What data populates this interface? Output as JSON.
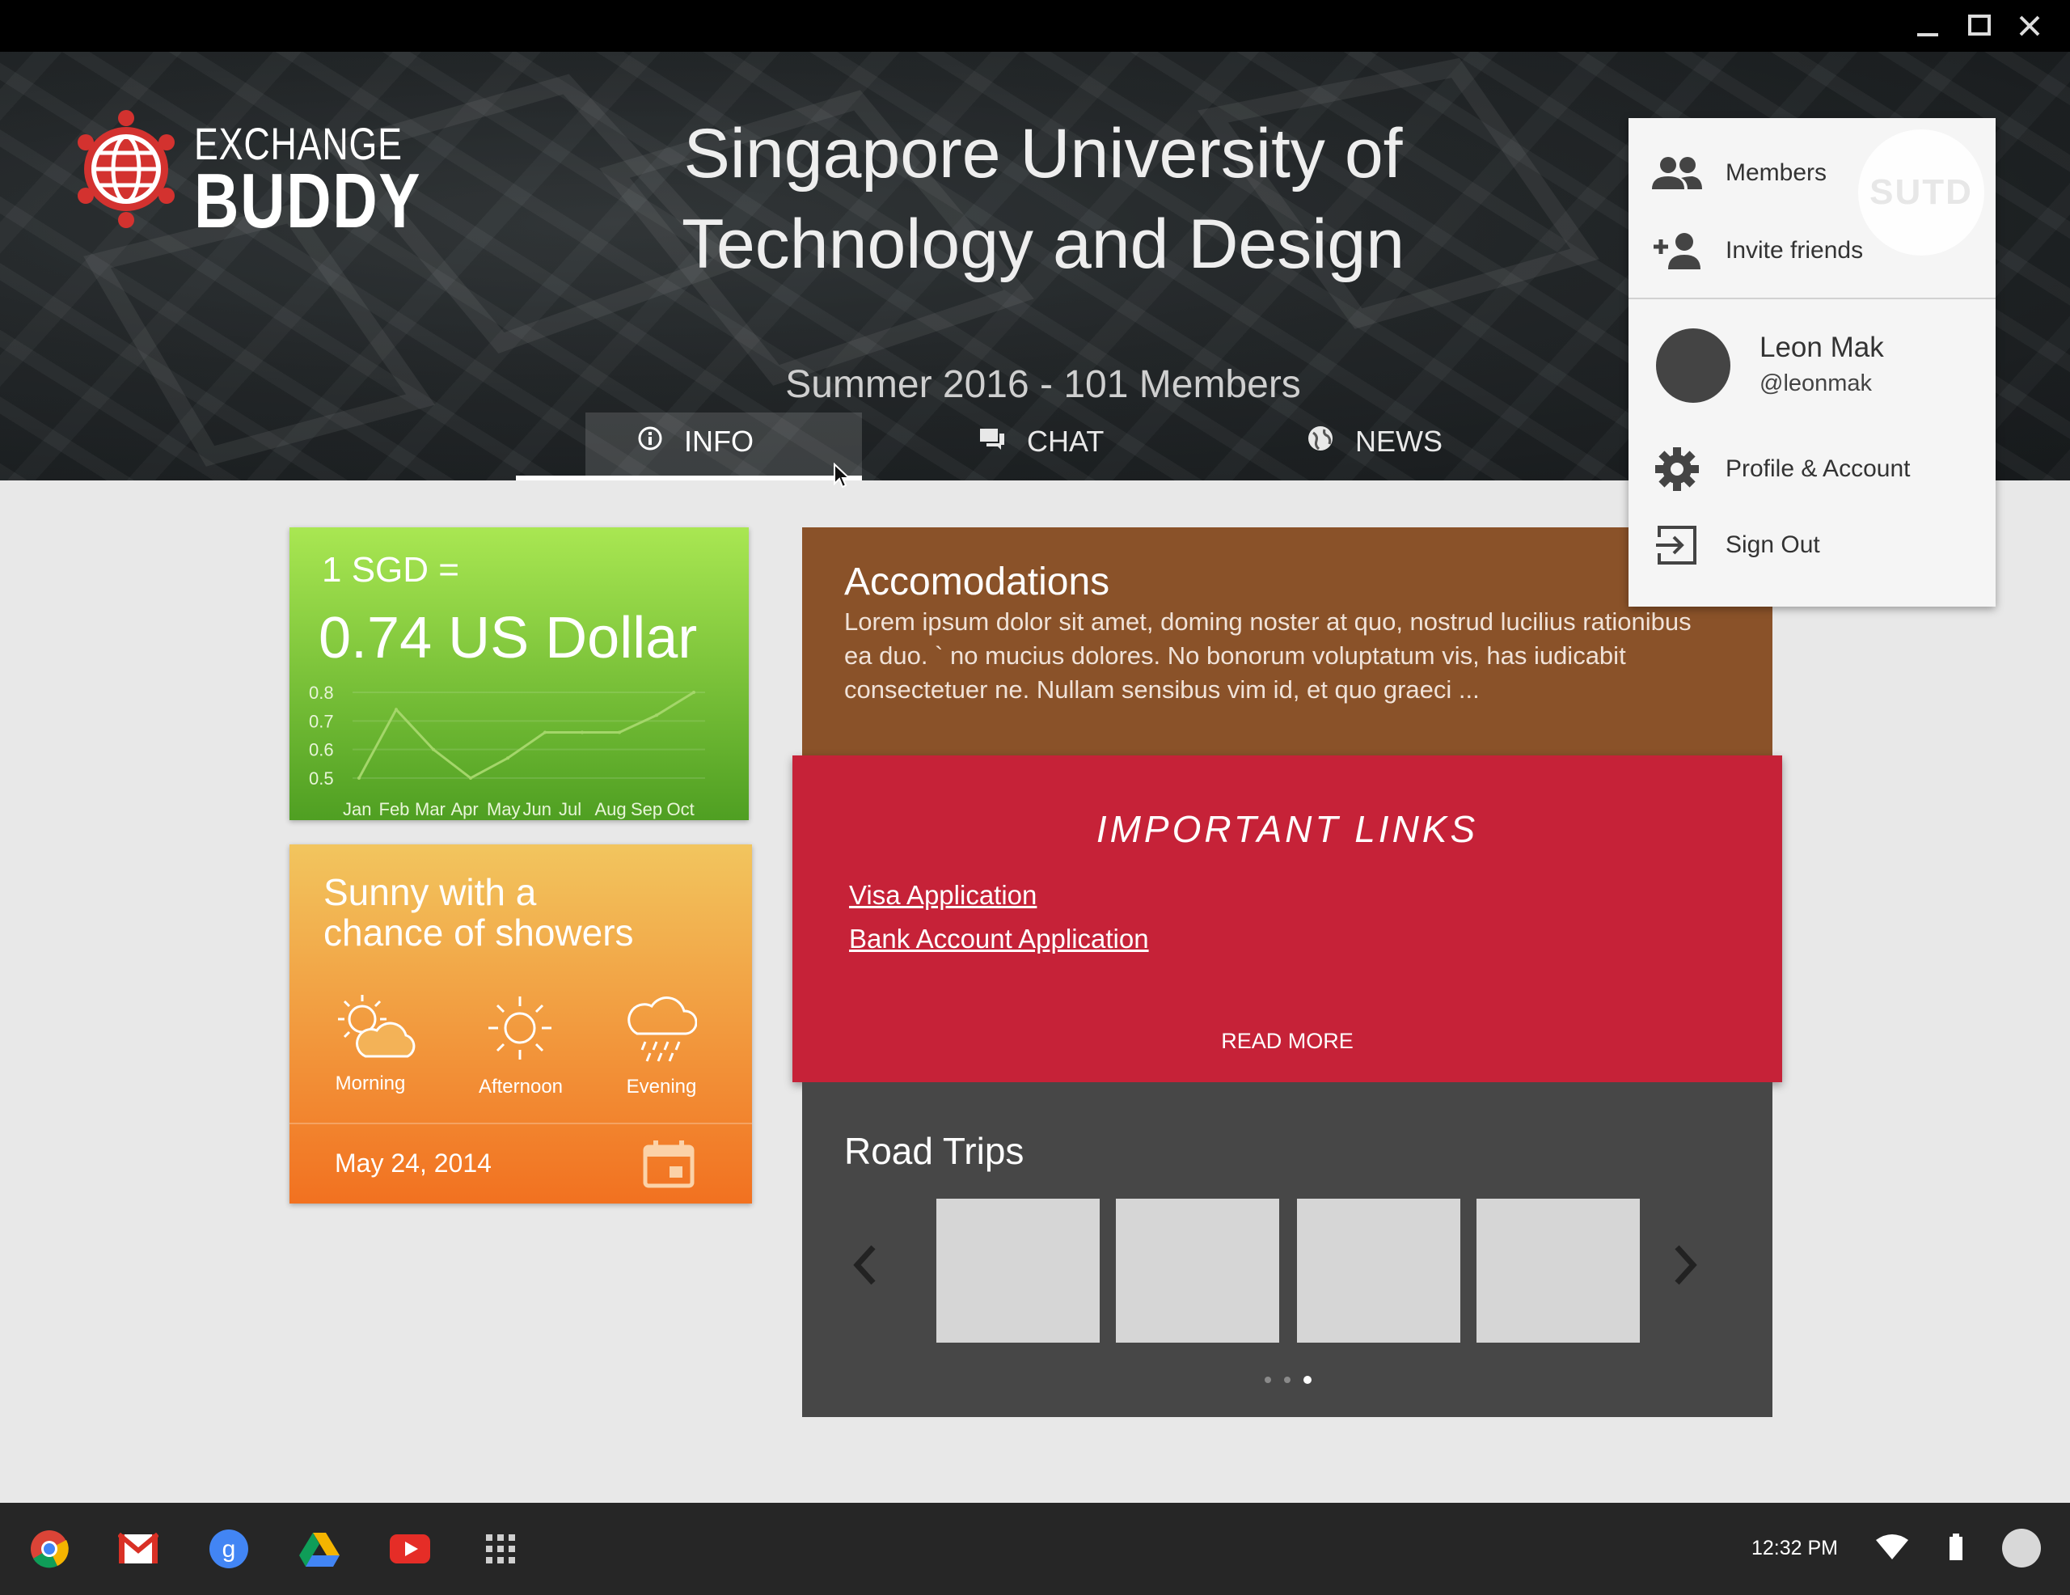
{
  "window": {
    "minimize_icon": "minimize-icon",
    "maximize_icon": "maximize-icon",
    "close_icon": "close-icon"
  },
  "header": {
    "logo_line1": "EXCHANGE",
    "logo_line2": "BUDDY",
    "title_line1": "Singapore University of",
    "title_line2": "Technology and Design",
    "subtitle": "Summer 2016 - 101 Members",
    "tabs": [
      {
        "label": "INFO",
        "icon": "info-icon",
        "active": true
      },
      {
        "label": "CHAT",
        "icon": "chat-icon",
        "active": false
      },
      {
        "label": "NEWS",
        "icon": "globe-icon",
        "active": false
      }
    ]
  },
  "currency": {
    "line1": "1 SGD =",
    "line2": "0.74 US Dollar",
    "chart_data": {
      "type": "line",
      "categories": [
        "Jan",
        "Feb",
        "Mar",
        "Apr",
        "May",
        "Jun",
        "Jul",
        "Aug",
        "Sep",
        "Oct"
      ],
      "values": [
        0.5,
        0.74,
        0.6,
        0.5,
        0.57,
        0.66,
        0.66,
        0.66,
        0.72,
        0.8
      ],
      "yticks": [
        "0.8",
        "0.7",
        "0.6",
        "0.5"
      ],
      "ylim": [
        0.5,
        0.8
      ],
      "color": "#a4d66a"
    }
  },
  "weather": {
    "summary_line1": "Sunny with a",
    "summary_line2": "chance of showers",
    "periods": [
      {
        "label": "Morning",
        "icon": "partly-cloudy-icon"
      },
      {
        "label": "Afternoon",
        "icon": "sun-icon"
      },
      {
        "label": "Evening",
        "icon": "rain-cloud-icon"
      }
    ],
    "date": "May 24, 2014",
    "calendar_icon": "calendar-icon"
  },
  "accommodations": {
    "title": "Accomodations",
    "body": "Lorem ipsum dolor sit amet, doming noster at quo, nostrud lucilius rationibus ea duo. ` no mucius dolores. No bonorum voluptatum vis, has iudicabit consectetuer ne. Nullam sensibus vim id, et quo graeci ..."
  },
  "important_links": {
    "title": "IMPORTANT LINKS",
    "links": [
      "Visa Application",
      "Bank Account Application"
    ],
    "read_more": "READ MORE"
  },
  "road_trips": {
    "title": "Road Trips",
    "pager_dots": 3,
    "active_dot": 3
  },
  "menu": {
    "watermark": "SUTD",
    "items_top": [
      {
        "label": "Members",
        "icon": "group-icon"
      },
      {
        "label": "Invite friends",
        "icon": "add-person-icon"
      }
    ],
    "user": {
      "name": "Leon Mak",
      "handle": "@leonmak"
    },
    "items_bottom": [
      {
        "label": "Profile & Account",
        "icon": "gear-icon"
      },
      {
        "label": "Sign Out",
        "icon": "sign-out-icon"
      }
    ]
  },
  "taskbar": {
    "apps": [
      "chrome-icon",
      "gmail-icon",
      "google-search-icon",
      "drive-icon",
      "youtube-icon",
      "app-launcher-icon"
    ],
    "time": "12:32 PM"
  }
}
